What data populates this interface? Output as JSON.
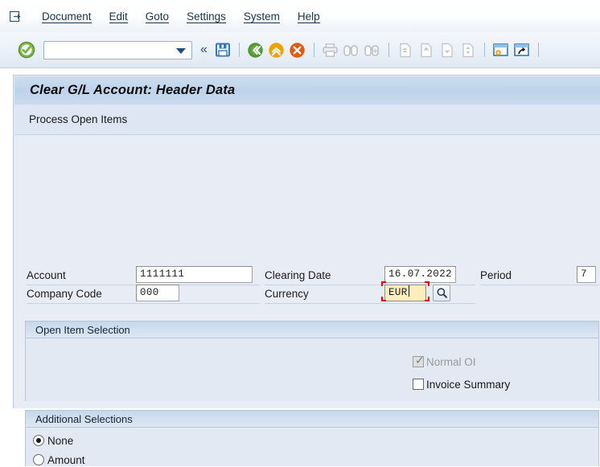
{
  "menubar": {
    "icon": "document-exit-icon",
    "items": [
      {
        "label": "Document",
        "accel": "D"
      },
      {
        "label": "Edit",
        "accel": "E"
      },
      {
        "label": "Goto",
        "accel": "G"
      },
      {
        "label": "Settings",
        "accel": "S"
      },
      {
        "label": "System",
        "accel": "y"
      },
      {
        "label": "Help",
        "accel": "H"
      }
    ]
  },
  "toolbar": {
    "enter_icon": "green-check-enter-icon",
    "command_field": {
      "value": "",
      "placeholder": ""
    },
    "dropdown_icon": "chevron-down-icon",
    "collapse_icon": "double-chevron-left-icon",
    "buttons": [
      {
        "name": "save-button",
        "icon": "floppy-disk-save-icon"
      },
      {
        "name": "back-button",
        "icon": "green-back-arrow-icon"
      },
      {
        "name": "exit-button",
        "icon": "yellow-up-arrow-exit-icon"
      },
      {
        "name": "cancel-button",
        "icon": "red-x-cancel-icon"
      },
      {
        "name": "print-button",
        "icon": "printer-icon"
      },
      {
        "name": "find-button",
        "icon": "binoculars-find-icon"
      },
      {
        "name": "find-next-button",
        "icon": "binoculars-star-find-next-icon"
      },
      {
        "name": "first-page-button",
        "icon": "page-first-icon"
      },
      {
        "name": "previous-page-button",
        "icon": "page-up-icon"
      },
      {
        "name": "next-page-button",
        "icon": "page-down-icon"
      },
      {
        "name": "last-page-button",
        "icon": "page-last-icon"
      },
      {
        "name": "create-session-button",
        "icon": "new-session-icon"
      },
      {
        "name": "create-shortcut-button",
        "icon": "shortcut-icon"
      }
    ]
  },
  "screen": {
    "title": "Clear G/L Account: Header Data",
    "subtitle_button": "Process Open Items"
  },
  "form": {
    "account": {
      "label": "Account",
      "value": "1111111"
    },
    "company_code": {
      "label": "Company Code",
      "value": "000"
    },
    "clearing_date": {
      "label": "Clearing Date",
      "value": "16.07.2022"
    },
    "currency": {
      "label": "Currency",
      "value": "EUR",
      "focused": true,
      "search_help_icon": "magnifier-search-help-icon"
    },
    "period": {
      "label": "Period",
      "value": "7"
    }
  },
  "open_item_selection": {
    "title": "Open Item Selection",
    "options": [
      {
        "label": "Normal OI",
        "checked": true,
        "disabled": true
      },
      {
        "label": "Invoice Summary",
        "checked": false,
        "disabled": false
      }
    ]
  },
  "additional_selections": {
    "title": "Additional Selections",
    "options": [
      {
        "label": "None",
        "selected": true
      },
      {
        "label": "Amount",
        "selected": false
      }
    ]
  },
  "colors": {
    "title_bar": "#c2d6ec",
    "panel_bg": "#e7ecf5",
    "focus_outline": "#e8000d",
    "focus_field_bg": "#ffeeba",
    "accent_blue": "#1c4f86"
  }
}
